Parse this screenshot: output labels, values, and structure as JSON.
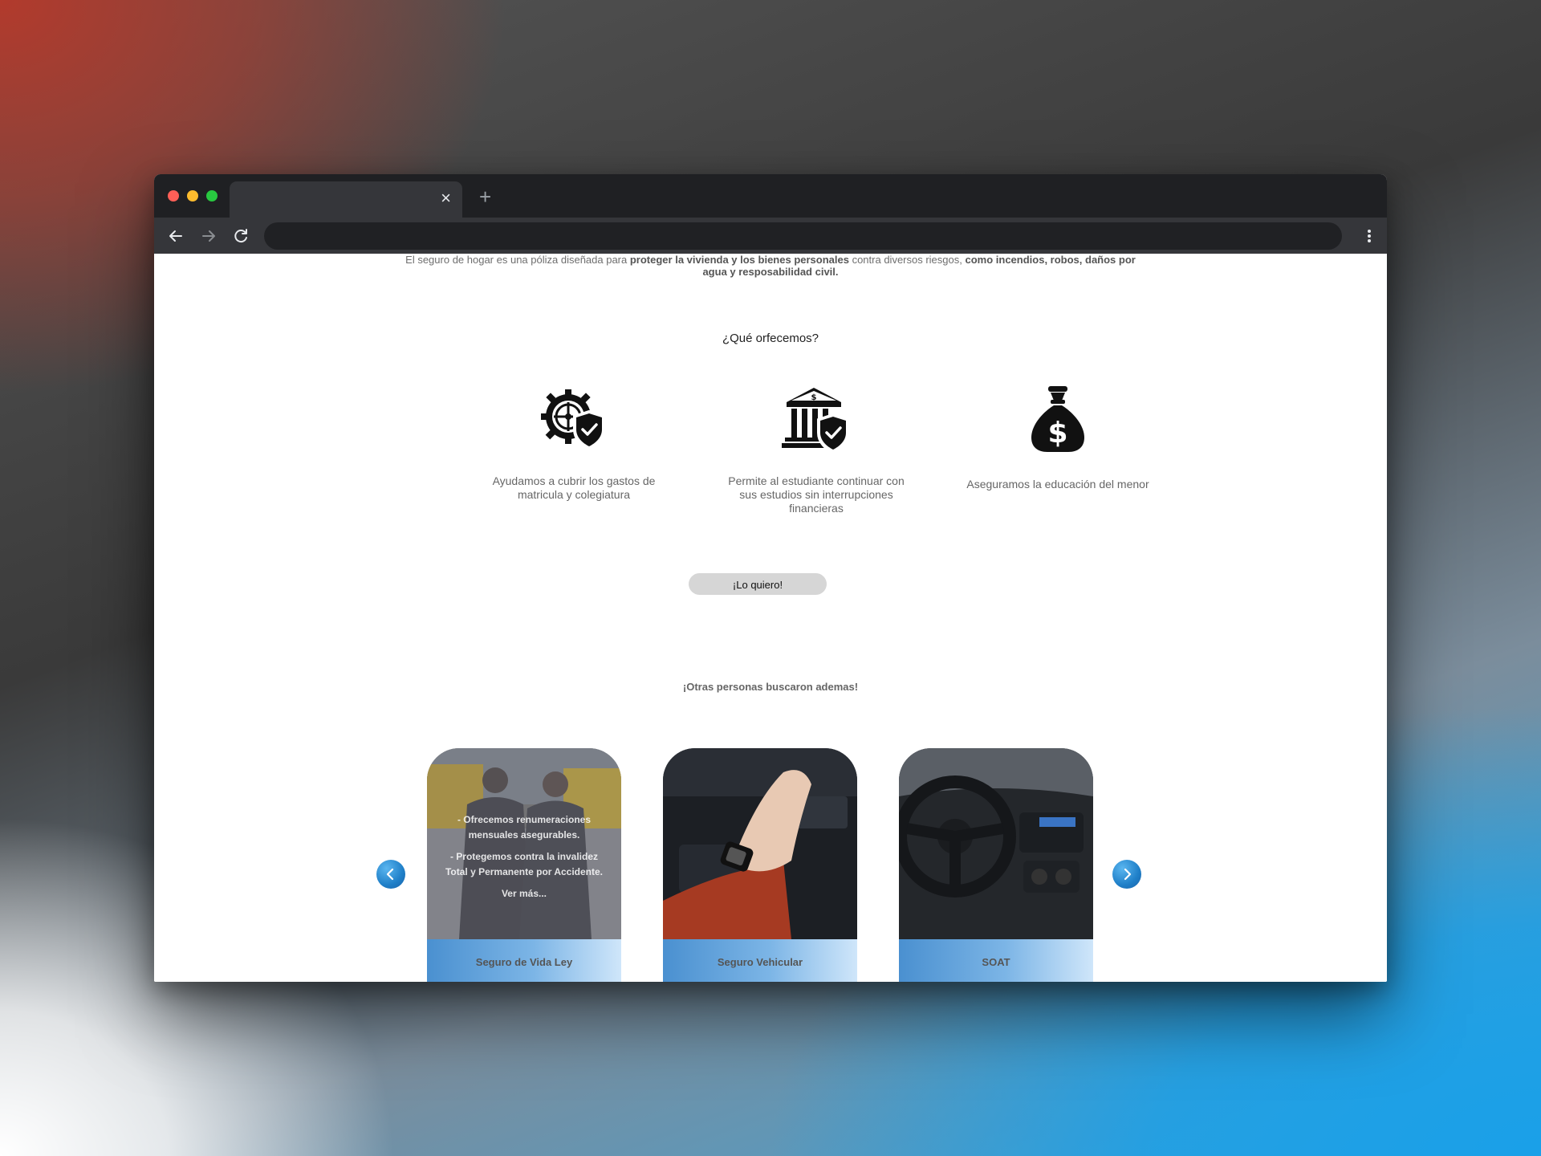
{
  "browser": {
    "tab_close": "×",
    "new_tab": "+"
  },
  "intro": {
    "p1": "El seguro de hogar es una póliza diseñada para ",
    "b1": "proteger la vivienda y los bienes personales",
    "p2": " contra diversos riesgos, ",
    "b2": "como incendios, robos, daños por agua y resposabilidad civil",
    "p3": "."
  },
  "offer": {
    "title": "¿Qué orfecemos?",
    "items": [
      {
        "icon": "gear-shield-icon",
        "text": "Ayudamos a cubrir los gastos de matricula y colegiatura"
      },
      {
        "icon": "bank-shield-icon",
        "text": "Permite al estudiante continuar con sus estudios sin interrupciones financieras"
      },
      {
        "icon": "money-bag-icon",
        "text": "Aseguramos la educación del menor"
      }
    ],
    "cta": "¡Lo quiero!"
  },
  "others": {
    "title": "¡Otras personas buscaron ademas!",
    "cards": [
      {
        "title": "Seguro de Vida Ley",
        "lines": [
          "- Ofrecemos renumeraciones mensuales asegurables.",
          "- Protegemos contra la invalidez Total y Permanente por Accidente.",
          "Ver más..."
        ]
      },
      {
        "title": "Seguro Vehicular"
      },
      {
        "title": "SOAT"
      }
    ]
  },
  "colors": {
    "accent_blue": "#1f7fc8",
    "cta_bg": "#d6d6d6"
  }
}
